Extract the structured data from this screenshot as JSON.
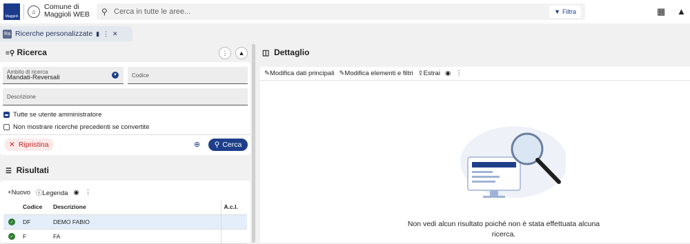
{
  "header": {
    "logo_text": "Maggioli",
    "org_name": "Comune di Maggioli WEB",
    "search_placeholder": "Cerca in tutte le aree...",
    "filter_label": "Filtra"
  },
  "tab": {
    "label": "Ricerche personalizzate",
    "icon_text": "Ra"
  },
  "ricerca": {
    "title": "Ricerca",
    "fields": {
      "ambito_label": "Ambito di ricerca",
      "ambito_value": "Mandati-Reversali",
      "codice_label": "Codice",
      "codice_value": "",
      "descrizione_label": "Descrizione",
      "descrizione_value": ""
    },
    "checkboxes": [
      {
        "label": "Tutte se utente amministratore",
        "checked": true
      },
      {
        "label": "Non mostrare ricerche precedenti se convertite",
        "checked": false
      }
    ],
    "reset_label": "Ripristina",
    "search_label": "Cerca"
  },
  "risultati": {
    "title": "Risultati",
    "toolbar": {
      "new_label": "Nuovo",
      "legend_label": "Legenda"
    },
    "columns": [
      "Codice",
      "Descrizione",
      "A.c.l."
    ],
    "rows": [
      {
        "codice": "DF",
        "descrizione": "DEMO FABIO",
        "acl": "",
        "active": true
      },
      {
        "codice": "F",
        "descrizione": "FA",
        "acl": "",
        "active": false
      }
    ]
  },
  "dettaglio": {
    "title": "Dettaglio",
    "toolbar": {
      "edit_main_label": "Modifica dati principali",
      "edit_elements_label": "Modifica elementi e filtri",
      "extract_label": "Estrai"
    },
    "empty_message": "Non vedi alcun risultato poiché non è stata effettuata alcuna ricerca."
  },
  "colors": {
    "primary": "#1e3f8a",
    "danger": "#c62828",
    "success": "#2e7d32",
    "background": "#f1f1f1"
  }
}
